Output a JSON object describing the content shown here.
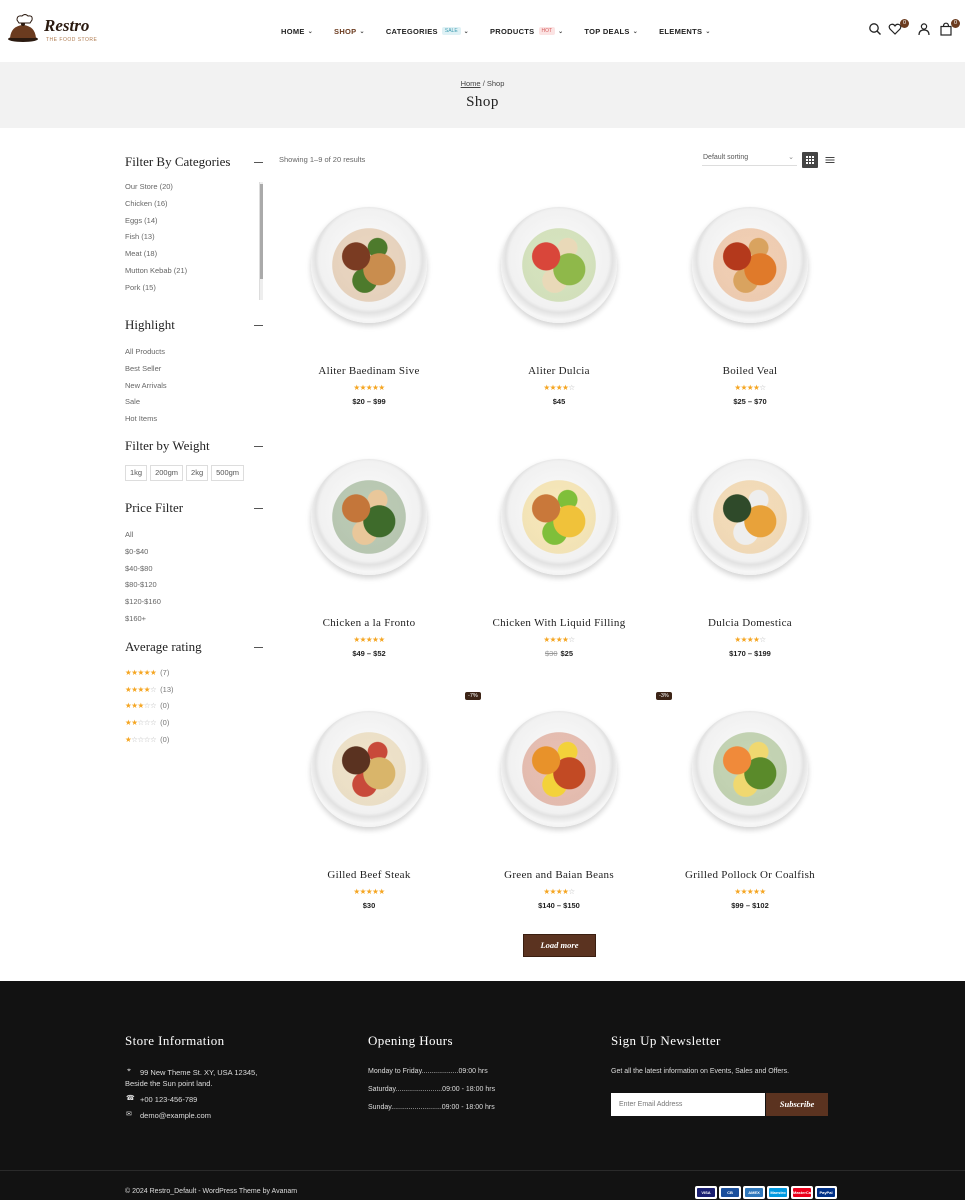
{
  "brand": {
    "name": "Restro",
    "tagline": "THE FOOD STORE"
  },
  "nav": [
    {
      "label": "HOME",
      "badge": ""
    },
    {
      "label": "SHOP",
      "badge": ""
    },
    {
      "label": "CATEGORIES",
      "badge": "SALE"
    },
    {
      "label": "PRODUCTS",
      "badge": "HOT"
    },
    {
      "label": "TOP DEALS",
      "badge": ""
    },
    {
      "label": "ELEMENTS",
      "badge": ""
    }
  ],
  "header_counts": {
    "wishlist": "0",
    "cart": "0"
  },
  "breadcrumb": {
    "home": "Home",
    "sep": " / ",
    "current": "Shop"
  },
  "page_title": "Shop",
  "sidebar": {
    "categories_title": "Filter By Categories",
    "categories": [
      "Our Store (20)",
      "Chicken (16)",
      "Eggs (14)",
      "Fish (13)",
      "Meat (18)",
      "Mutton Kebab (21)",
      "Pork (15)"
    ],
    "highlight_title": "Highlight",
    "highlight": [
      "All Products",
      "Best Seller",
      "New Arrivals",
      "Sale",
      "Hot Items"
    ],
    "weight_title": "Filter by Weight",
    "weights": [
      "1kg",
      "200gm",
      "2kg",
      "500gm"
    ],
    "price_title": "Price Filter",
    "prices": [
      "All",
      "$0-$40",
      "$40-$80",
      "$80-$120",
      "$120-$160",
      "$160+"
    ],
    "rating_title": "Average rating",
    "ratings": [
      {
        "stars": 5,
        "count": "(7)"
      },
      {
        "stars": 4,
        "count": "(13)"
      },
      {
        "stars": 3,
        "count": "(0)"
      },
      {
        "stars": 2,
        "count": "(0)"
      },
      {
        "stars": 1,
        "count": "(0)"
      }
    ]
  },
  "toolbar": {
    "showing": "Showing 1–9 of 20 results",
    "sort": "Default sorting"
  },
  "products": [
    {
      "name": "Aliter Baedinam Sive",
      "rating": 5,
      "price": "$20 – $99",
      "old_price": "",
      "discount": "",
      "colors": [
        "#7a3b22",
        "#c98d4e",
        "#4d7a2c"
      ]
    },
    {
      "name": "Aliter Dulcia",
      "rating": 4,
      "price": "$45",
      "old_price": "",
      "discount": "",
      "colors": [
        "#d9463a",
        "#8fb84a",
        "#e9d9b8"
      ]
    },
    {
      "name": "Boiled Veal",
      "rating": 4,
      "price": "$25 – $70",
      "old_price": "",
      "discount": "",
      "colors": [
        "#b4391c",
        "#e07a2a",
        "#d9a35f"
      ]
    },
    {
      "name": "Chicken a la Fronto",
      "rating": 5,
      "price": "$49 – $52",
      "old_price": "",
      "discount": "",
      "colors": [
        "#c4763a",
        "#3e6b2b",
        "#e9c79a"
      ]
    },
    {
      "name": "Chicken With Liquid Filling",
      "rating": 4,
      "price": "$25",
      "old_price": "$30",
      "discount": "",
      "colors": [
        "#c9783a",
        "#f0c23a",
        "#7fbf3a"
      ]
    },
    {
      "name": "Dulcia Domestica",
      "rating": 4,
      "price": "$170 – $199",
      "old_price": "",
      "discount": "",
      "colors": [
        "#2f4a2a",
        "#e8a23a",
        "#eeeeee"
      ]
    },
    {
      "name": "Gilled Beef Steak",
      "rating": 5,
      "price": "$30",
      "old_price": "",
      "discount": "",
      "colors": [
        "#5a3220",
        "#d9b56a",
        "#c84a3a"
      ]
    },
    {
      "name": "Green and Baian Beans",
      "rating": 4,
      "price": "$140 – $150",
      "old_price": "",
      "discount": "-7%",
      "colors": [
        "#e8922a",
        "#c24a24",
        "#f3d23a"
      ]
    },
    {
      "name": "Grilled Pollock Or Coalfish",
      "rating": 5,
      "price": "$99 – $102",
      "old_price": "",
      "discount": "-3%",
      "colors": [
        "#f08a3a",
        "#5a8a2a",
        "#f0d870"
      ]
    }
  ],
  "load_more": "Load more",
  "footer": {
    "store_title": "Store Information",
    "address": "99 New Theme St. XY, USA 12345, Beside the Sun point land.",
    "phone": "+00 123-456-789",
    "email": "demo@example.com",
    "hours_title": "Opening Hours",
    "hours": [
      "Monday to Friday...................09:00 hrs",
      "Saturday........................09:00 - 18:00 hrs",
      "Sunday..........................09:00 - 18:00 hrs"
    ],
    "newsletter_title": "Sign Up Newsletter",
    "newsletter_text": "Get all the latest information on Events, Sales and Offers.",
    "email_placeholder": "Enter Email Address",
    "subscribe": "Subscribe",
    "copyright": "© 2024 Restro_Default - WordPress Theme by Avanam",
    "payments": [
      "VISA",
      "CB",
      "AMEX",
      "Maestro",
      "MasterCard",
      "PayPal"
    ]
  },
  "colors": {
    "brand_brown": "#5b3320",
    "star": "#f5a623",
    "footer_bg": "#121212"
  }
}
